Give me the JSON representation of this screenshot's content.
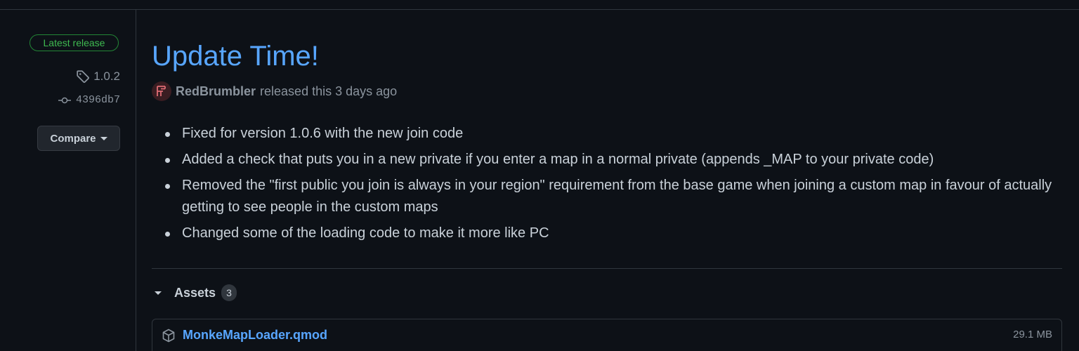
{
  "sidebar": {
    "badge": "Latest release",
    "tag": "1.0.2",
    "commit": "4396db7",
    "compare_label": "Compare"
  },
  "release": {
    "title": "Update Time!",
    "author": "RedBrumbler",
    "released_text": "released this 3 days ago",
    "notes": [
      "Fixed for version 1.0.6 with the new join code",
      "Added a check that puts you in a new private if you enter a map in a normal private (appends _MAP to your private code)",
      "Removed the \"first public you join is always in your region\" requirement from the base game when joining a custom map in favour of actually getting to see people in the custom maps",
      "Changed some of the loading code to make it more like PC"
    ]
  },
  "assets": {
    "title": "Assets",
    "count": "3",
    "items": [
      {
        "name": "MonkeMapLoader.qmod",
        "size": "29.1 MB"
      }
    ]
  },
  "colors": {
    "background": "#0d1117",
    "link": "#58a6ff",
    "badge_green": "#3fb950",
    "muted": "#8b949e"
  },
  "icons": {
    "tag": "tag-icon",
    "commit": "git-commit-icon",
    "package": "package-icon",
    "avatar": "avatar"
  }
}
